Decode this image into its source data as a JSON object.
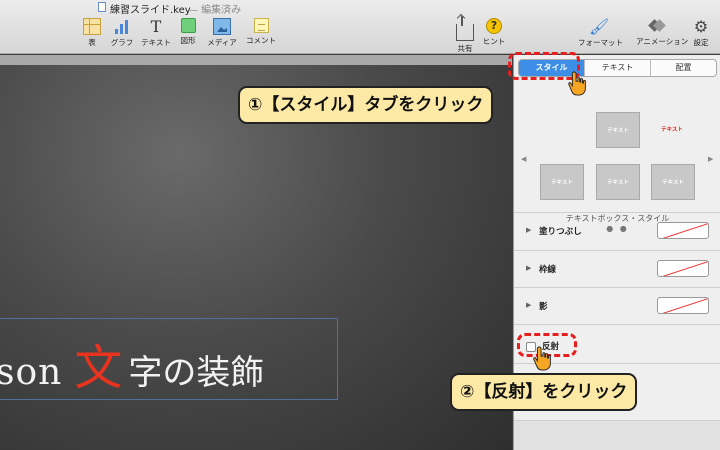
{
  "window": {
    "filename": "練習スライド.key",
    "edited": "— 編集済み"
  },
  "toolbar": {
    "left": [
      {
        "label": "表",
        "icon": "table-icon"
      },
      {
        "label": "グラフ",
        "icon": "chart-icon"
      },
      {
        "label": "テキスト",
        "icon": "text-icon",
        "glyph": "T"
      },
      {
        "label": "図形",
        "icon": "shape-icon"
      },
      {
        "label": "メディア",
        "icon": "media-icon"
      },
      {
        "label": "コメント",
        "icon": "comment-icon"
      }
    ],
    "right": [
      {
        "label": "共有",
        "icon": "share-icon"
      },
      {
        "label": "ヒント",
        "icon": "hint-icon",
        "glyph": "?"
      },
      {
        "label": "フォーマット",
        "icon": "format-brush-icon",
        "glyph": "🖌"
      },
      {
        "label": "アニメーション",
        "icon": "animation-icon"
      },
      {
        "label": "設定",
        "icon": "settings-gear-icon",
        "glyph": "⚙"
      }
    ]
  },
  "slide": {
    "text_a": "son",
    "text_b": "文",
    "text_c": "字の装飾"
  },
  "inspector": {
    "tabs": [
      "スタイル",
      "テキスト",
      "配置"
    ],
    "active_tab": "スタイル",
    "style_thumbs": [
      "テキスト",
      "テキスト",
      "テキスト",
      "テキスト",
      "テキスト"
    ],
    "styles_caption": "テキストボックス・スタイル",
    "dots": "● ●",
    "tri": "▶",
    "rows": [
      {
        "label": "塗りつぶし"
      },
      {
        "label": "枠線"
      },
      {
        "label": "影"
      }
    ],
    "reflection_label": "反射",
    "arrow_left": "◀",
    "arrow_right": "▶"
  },
  "callouts": {
    "step1": "①【スタイル】タブをクリック",
    "step2": "②【反射】をクリック"
  },
  "colors": {
    "accent": "#3d8ee6",
    "callout_bg": "#fce9a6",
    "highlight": "#e61e1e",
    "slide_red": "#e8331f"
  }
}
